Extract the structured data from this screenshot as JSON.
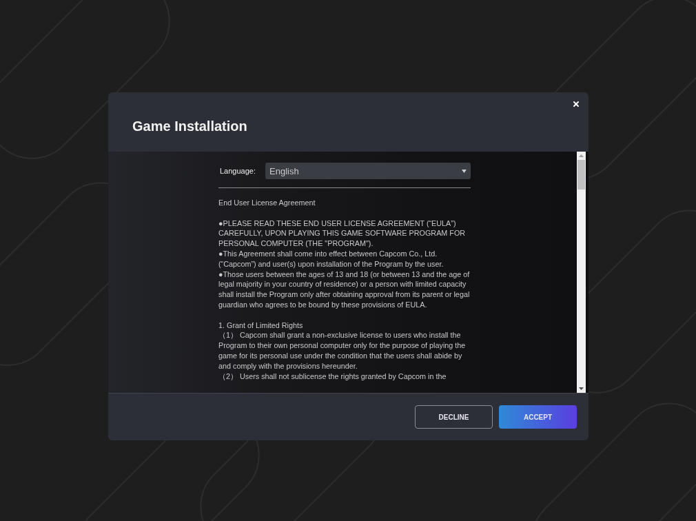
{
  "dialog": {
    "title": "Game Installation"
  },
  "language": {
    "label": "Language:",
    "value": "English"
  },
  "eula": {
    "heading": "End User License Agreement",
    "sections": [
      {
        "paragraphs": [
          "●PLEASE READ THESE END USER LICENSE AGREEMENT (“EULA”) CAREFULLY, UPON PLAYING THIS GAME SOFTWARE PROGRAM FOR PERSONAL COMPUTER (THE \"PROGRAM\").",
          "●This Agreement shall come into effect between Capcom Co., Ltd. (“Capcom”) and user(s) upon installation of the Program by the user.",
          "●Those users between the ages of 13 and 18 (or between 13 and the age of legal majority in your country of residence) or a person with limited capacity shall install the Program only after obtaining approval from its parent or legal guardian who agrees to be bound by these provisions of EULA."
        ]
      },
      {
        "paragraphs": [
          "1. Grant of Limited Rights",
          "（1） Capcom shall grant a non-exclusive license to users who install the Program to their own personal computer only for the purpose of playing the game for its personal use under the condition that the users shall abide by and comply with the provisions hereunder.",
          "（2） Users shall not sublicense the rights granted by Capcom in the"
        ]
      }
    ]
  },
  "buttons": [
    {
      "label": "DECLINE",
      "kind": "secondary"
    },
    {
      "label": "ACCEPT",
      "kind": "primary"
    }
  ]
}
